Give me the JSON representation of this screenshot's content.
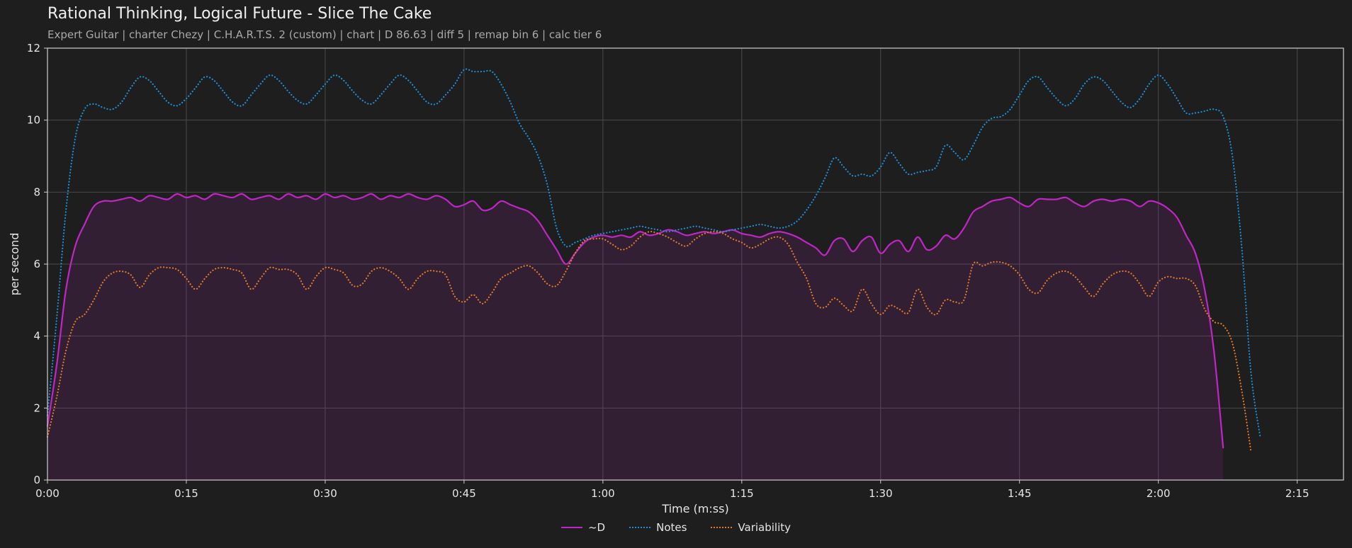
{
  "chart_data": {
    "type": "line",
    "title": "Rational Thinking, Logical Future - Slice The Cake",
    "subtitle": "Expert Guitar  |  charter Chezy  |  C.H.A.R.T.S. 2 (custom)  |  chart  |  D 86.63  |  diff 5  |  remap bin 6  |  calc tier 6",
    "xlabel": "Time (m:ss)",
    "ylabel": "per second",
    "xlim": [
      0,
      140
    ],
    "ylim": [
      0,
      12
    ],
    "x_ticks": [
      0,
      15,
      30,
      45,
      60,
      75,
      90,
      105,
      120,
      135
    ],
    "x_tick_labels": [
      "0:00",
      "0:15",
      "0:30",
      "0:45",
      "1:00",
      "1:15",
      "1:30",
      "1:45",
      "2:00",
      "2:15"
    ],
    "y_ticks": [
      0,
      2,
      4,
      6,
      8,
      10,
      12
    ],
    "y_tick_labels": [
      "0",
      "2",
      "4",
      "6",
      "8",
      "10",
      "12"
    ],
    "grid": true,
    "legend_position": "bottom-center",
    "x": [
      0,
      1,
      2,
      3,
      4,
      5,
      6,
      7,
      8,
      9,
      10,
      11,
      12,
      13,
      14,
      15,
      16,
      17,
      18,
      19,
      20,
      21,
      22,
      23,
      24,
      25,
      26,
      27,
      28,
      29,
      30,
      31,
      32,
      33,
      34,
      35,
      36,
      37,
      38,
      39,
      40,
      41,
      42,
      43,
      44,
      45,
      46,
      47,
      48,
      49,
      50,
      51,
      52,
      53,
      54,
      55,
      56,
      57,
      58,
      59,
      60,
      61,
      62,
      63,
      64,
      65,
      66,
      67,
      68,
      69,
      70,
      71,
      72,
      73,
      74,
      75,
      76,
      77,
      78,
      79,
      80,
      81,
      82,
      83,
      84,
      85,
      86,
      87,
      88,
      89,
      90,
      91,
      92,
      93,
      94,
      95,
      96,
      97,
      98,
      99,
      100,
      101,
      102,
      103,
      104,
      105,
      106,
      107,
      108,
      109,
      110,
      111,
      112,
      113,
      114,
      115,
      116,
      117,
      118,
      119,
      120,
      121,
      122,
      123,
      124,
      125,
      126,
      127,
      128,
      129,
      130,
      131,
      132,
      133,
      134,
      135,
      136,
      137,
      138,
      139,
      140
    ],
    "series": [
      {
        "name": "~D",
        "color": "#c026c6",
        "style": "solid",
        "fill": true,
        "values": [
          1.5,
          3.2,
          5.3,
          6.5,
          7.1,
          7.6,
          7.75,
          7.75,
          7.8,
          7.85,
          7.75,
          7.9,
          7.85,
          7.8,
          7.95,
          7.85,
          7.9,
          7.8,
          7.95,
          7.9,
          7.85,
          7.95,
          7.8,
          7.85,
          7.9,
          7.8,
          7.95,
          7.85,
          7.9,
          7.8,
          7.95,
          7.85,
          7.9,
          7.8,
          7.85,
          7.95,
          7.8,
          7.9,
          7.85,
          7.95,
          7.85,
          7.8,
          7.9,
          7.8,
          7.6,
          7.65,
          7.75,
          7.5,
          7.55,
          7.75,
          7.65,
          7.55,
          7.45,
          7.2,
          6.8,
          6.4,
          6.0,
          6.3,
          6.6,
          6.75,
          6.8,
          6.75,
          6.8,
          6.75,
          6.9,
          6.8,
          6.85,
          6.95,
          6.9,
          6.8,
          6.85,
          6.9,
          6.85,
          6.9,
          6.95,
          6.85,
          6.8,
          6.75,
          6.85,
          6.9,
          6.85,
          6.75,
          6.6,
          6.45,
          6.25,
          6.65,
          6.7,
          6.35,
          6.65,
          6.75,
          6.3,
          6.55,
          6.65,
          6.35,
          6.75,
          6.4,
          6.5,
          6.8,
          6.7,
          7.0,
          7.45,
          7.6,
          7.75,
          7.8,
          7.85,
          7.7,
          7.6,
          7.8,
          7.8,
          7.8,
          7.85,
          7.7,
          7.6,
          7.75,
          7.8,
          7.75,
          7.8,
          7.75,
          7.6,
          7.75,
          7.7,
          7.55,
          7.3,
          6.8,
          6.3,
          5.3,
          3.6,
          0.9
        ]
      },
      {
        "name": "Notes",
        "color": "#1f8ed8",
        "style": "dotted",
        "fill": false,
        "values": [
          1.8,
          4.5,
          7.5,
          9.5,
          10.3,
          10.45,
          10.35,
          10.3,
          10.5,
          10.9,
          11.2,
          11.1,
          10.8,
          10.5,
          10.4,
          10.6,
          10.9,
          11.2,
          11.1,
          10.8,
          10.5,
          10.4,
          10.7,
          11.0,
          11.25,
          11.1,
          10.8,
          10.55,
          10.45,
          10.7,
          11.0,
          11.25,
          11.1,
          10.8,
          10.55,
          10.45,
          10.7,
          11.0,
          11.25,
          11.1,
          10.8,
          10.5,
          10.45,
          10.7,
          11.0,
          11.4,
          11.35,
          11.35,
          11.35,
          11.0,
          10.5,
          9.9,
          9.5,
          9.0,
          8.2,
          7.0,
          6.5,
          6.6,
          6.7,
          6.8,
          6.85,
          6.9,
          6.95,
          7.0,
          7.05,
          7.0,
          6.95,
          6.9,
          6.95,
          7.0,
          7.05,
          7.0,
          6.95,
          6.9,
          6.95,
          7.0,
          7.05,
          7.1,
          7.05,
          7.0,
          7.05,
          7.2,
          7.5,
          7.9,
          8.4,
          8.95,
          8.7,
          8.45,
          8.5,
          8.45,
          8.7,
          9.1,
          8.8,
          8.5,
          8.55,
          8.6,
          8.7,
          9.3,
          9.1,
          8.9,
          9.3,
          9.8,
          10.05,
          10.1,
          10.3,
          10.7,
          11.1,
          11.2,
          10.9,
          10.6,
          10.4,
          10.6,
          11.0,
          11.2,
          11.1,
          10.8,
          10.5,
          10.35,
          10.6,
          11.0,
          11.25,
          11.0,
          10.6,
          10.2,
          10.2,
          10.25,
          10.3,
          10.1,
          9.0,
          6.5,
          3.0,
          1.2
        ]
      },
      {
        "name": "Variability",
        "color": "#e07a28",
        "style": "dotted",
        "fill": false,
        "values": [
          1.2,
          2.3,
          3.6,
          4.4,
          4.6,
          5.0,
          5.5,
          5.75,
          5.8,
          5.7,
          5.35,
          5.7,
          5.9,
          5.9,
          5.85,
          5.6,
          5.3,
          5.6,
          5.85,
          5.9,
          5.85,
          5.75,
          5.3,
          5.6,
          5.9,
          5.85,
          5.85,
          5.7,
          5.3,
          5.65,
          5.9,
          5.85,
          5.75,
          5.4,
          5.45,
          5.8,
          5.9,
          5.8,
          5.6,
          5.3,
          5.6,
          5.8,
          5.8,
          5.7,
          5.1,
          4.95,
          5.15,
          4.9,
          5.2,
          5.6,
          5.75,
          5.9,
          5.95,
          5.75,
          5.45,
          5.4,
          5.8,
          6.3,
          6.65,
          6.7,
          6.7,
          6.55,
          6.4,
          6.5,
          6.75,
          6.9,
          6.85,
          6.75,
          6.6,
          6.5,
          6.7,
          6.85,
          6.9,
          6.85,
          6.7,
          6.6,
          6.45,
          6.55,
          6.7,
          6.75,
          6.55,
          6.05,
          5.6,
          4.9,
          4.8,
          5.05,
          4.85,
          4.7,
          5.3,
          4.9,
          4.6,
          4.85,
          4.75,
          4.65,
          5.3,
          4.8,
          4.6,
          5.0,
          4.95,
          5.0,
          6.0,
          5.95,
          6.05,
          6.05,
          5.95,
          5.7,
          5.3,
          5.2,
          5.55,
          5.75,
          5.8,
          5.65,
          5.35,
          5.1,
          5.45,
          5.7,
          5.8,
          5.75,
          5.45,
          5.1,
          5.5,
          5.65,
          5.6,
          5.6,
          5.4,
          4.75,
          4.4,
          4.3,
          3.8,
          2.5,
          0.8
        ]
      }
    ]
  }
}
